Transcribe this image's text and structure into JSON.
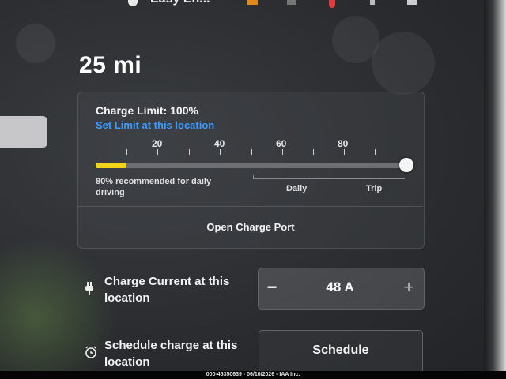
{
  "status_bar": {
    "profile_name": "Easy En...",
    "icons": [
      "profile-icon",
      "charging-icon",
      "square-icon",
      "location-pin-icon",
      "bluetooth-icon",
      "signal-icon"
    ]
  },
  "range": "25 mi",
  "charge_card": {
    "title": "Charge Limit: 100%",
    "set_limit_link": "Set Limit at this location",
    "ticks": [
      "20",
      "40",
      "60",
      "80"
    ],
    "limit_percent": 100,
    "current_charge_percent": 10,
    "hint": "80% recommended for daily driving",
    "daily_label": "Daily",
    "trip_label": "Trip",
    "open_port_label": "Open Charge Port",
    "colors": {
      "fill": "#f2d51a",
      "link": "#3b9bff"
    }
  },
  "charge_current": {
    "label": "Charge Current at this location",
    "minus": "−",
    "value": "48 A",
    "plus": "+"
  },
  "schedule": {
    "label": "Schedule charge at this location",
    "button_label": "Schedule"
  },
  "watermark": "000-45350639 - 06/10/2026 - IAA Inc."
}
